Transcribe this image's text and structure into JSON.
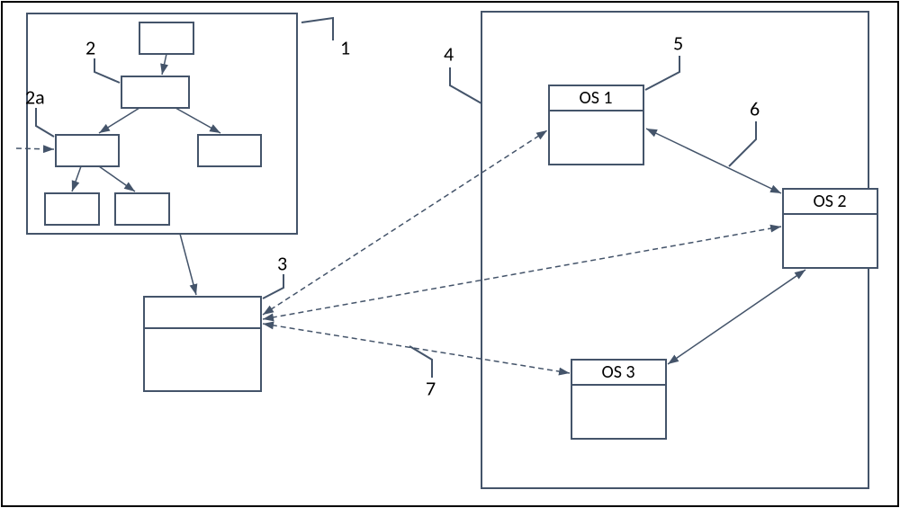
{
  "labels": {
    "l1": "1",
    "l2": "2",
    "l2a": "2a",
    "l3": "3",
    "l4": "4",
    "l5": "5",
    "l6": "6",
    "l7": "7"
  },
  "nodes": {
    "os1": "OS 1",
    "os2": "OS 2",
    "os3": "OS 3"
  }
}
